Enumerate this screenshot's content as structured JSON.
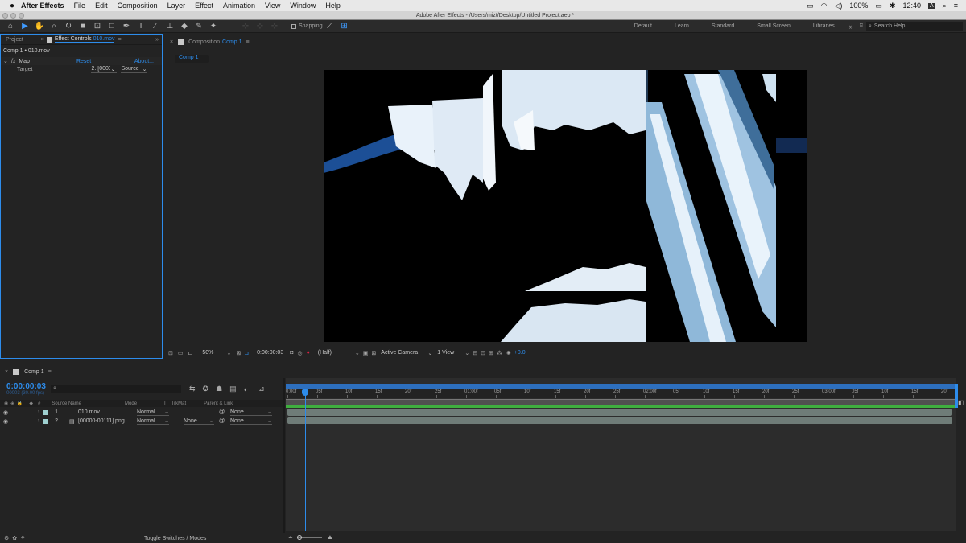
{
  "menubar": {
    "app": "After Effects",
    "items": [
      "File",
      "Edit",
      "Composition",
      "Layer",
      "Effect",
      "Animation",
      "View",
      "Window",
      "Help"
    ],
    "battery": "100%",
    "time": "12:40",
    "input_source": "A"
  },
  "titlebar": {
    "title": "Adobe After Effects - /Users/mizt/Desktop/Untitled Project.aep *"
  },
  "toolbar": {
    "snapping": "Snapping",
    "workspaces": [
      "Default",
      "Learn",
      "Standard",
      "Small Screen",
      "Libraries"
    ],
    "search_placeholder": "Search Help",
    "more": "»"
  },
  "left_panel": {
    "tab_project": "Project",
    "tab_effect_prefix": "Effect Controls",
    "tab_effect_layer": "010.mov",
    "path": "Comp 1 • 010.mov",
    "effect_fx": "fx",
    "effect_name": "Map",
    "reset": "Reset",
    "about": "About...",
    "param_label": "Target",
    "param_value1": "2. [0000",
    "param_value2": "Source"
  },
  "comp_panel": {
    "tab_prefix": "Composition",
    "tab_name": "Comp 1",
    "sub_tab": "Comp 1",
    "zoom": "50%",
    "timecode": "0:00:00:03",
    "resolution": "(Half)",
    "camera": "Active Camera",
    "view": "1 View",
    "exposure": "+0.0"
  },
  "timeline": {
    "tab": "Comp 1",
    "timecode": "0:00:00:03",
    "frame_info": "00003 (30.00 fps)",
    "search_placeholder": "",
    "headers": {
      "source": "Source Name",
      "mode": "Mode",
      "t": "T",
      "trkmat": "TrkMat",
      "parent": "Parent & Link"
    },
    "layers": [
      {
        "num": "1",
        "name": "010.mov",
        "mode": "Normal",
        "trkmat": "",
        "parent": "None"
      },
      {
        "num": "2",
        "name": "[00000-00111].png",
        "mode": "Normal",
        "trkmat": "None",
        "parent": "None"
      }
    ],
    "ruler": [
      "0:00f",
      "05f",
      "10f",
      "15f",
      "20f",
      "25f",
      "01:00f",
      "05f",
      "10f",
      "15f",
      "20f",
      "25f",
      "02:00f",
      "05f",
      "10f",
      "15f",
      "20f",
      "25f",
      "03:00f",
      "05f",
      "10f",
      "15f",
      "20f"
    ],
    "toggle": "Toggle Switches / Modes",
    "playhead_fraction": 0.03
  },
  "colors": {
    "accent": "#2d8ceb",
    "bar_green": "#3fae3f",
    "layer_bar": "#6f7c78"
  }
}
